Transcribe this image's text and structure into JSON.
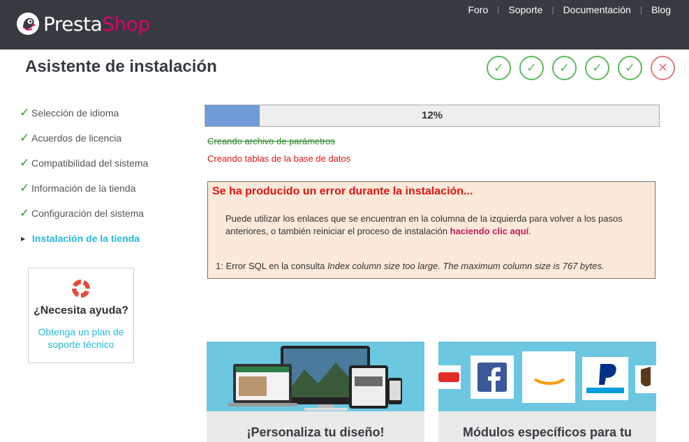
{
  "header": {
    "logo_part1": "Presta",
    "logo_part2": "Shop",
    "nav": [
      {
        "label": "Foro"
      },
      {
        "label": "Soporte"
      },
      {
        "label": "Documentación"
      },
      {
        "label": "Blog"
      }
    ]
  },
  "wizard": {
    "title": "Asistente de instalación",
    "steps": [
      {
        "status": "done",
        "icon": "check-icon"
      },
      {
        "status": "done",
        "icon": "check-icon"
      },
      {
        "status": "done",
        "icon": "check-icon"
      },
      {
        "status": "done",
        "icon": "check-icon"
      },
      {
        "status": "done",
        "icon": "check-icon"
      },
      {
        "status": "error",
        "icon": "close-icon"
      }
    ]
  },
  "sidebar": {
    "items": [
      {
        "label": "Selección de idioma",
        "status": "done"
      },
      {
        "label": "Acuerdos de licencia",
        "status": "done"
      },
      {
        "label": "Compatibilidad del sistema",
        "status": "done"
      },
      {
        "label": "Información de la tienda",
        "status": "done"
      },
      {
        "label": "Configuración del sistema",
        "status": "done"
      },
      {
        "label": "Instalación de la tienda",
        "status": "active"
      }
    ],
    "help": {
      "title": "¿Necesita ayuda?",
      "link": "Obtenga un plan de soporte técnico"
    }
  },
  "progress": {
    "value_percent": 12,
    "label": "12%"
  },
  "log": {
    "done": "Creando archivo de parámetros",
    "current": "Creando tablas de la base de datos"
  },
  "error": {
    "title": "Se ha producido un error durante la instalación...",
    "message_before": "Puede utilizar los enlaces que se encuentran en la columna de la izquierda para volver a los pasos anteriores, o también reiniciar el proceso de instalación ",
    "message_link": "haciendo clic aquí",
    "message_after": ".",
    "detail_prefix": "1: Error SQL en la consulta ",
    "detail_italic": "Index column size too large. The maximum column size is 767 bytes."
  },
  "promos": [
    {
      "title": "¡Personaliza tu diseño!"
    },
    {
      "title": "Módulos específicos para tu"
    }
  ],
  "colors": {
    "header_bg": "#363a41",
    "brand_pink": "#df0067",
    "accent_cyan": "#25b9d7",
    "success_green": "#5cb85c",
    "error_red": "#e01515",
    "progress_fill": "#6f9bd8",
    "error_box_bg": "#fce9da"
  }
}
